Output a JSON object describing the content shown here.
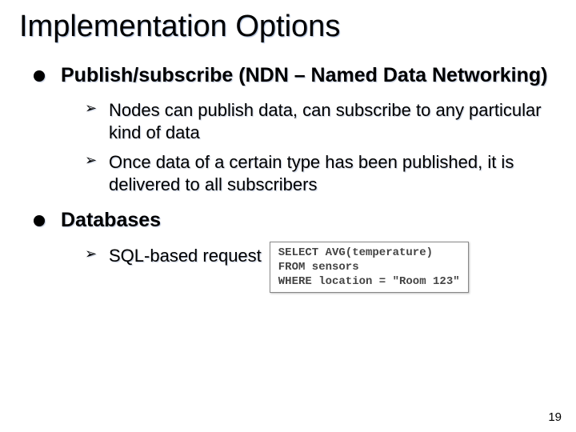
{
  "title": "Implementation Options",
  "points": [
    {
      "text": "Publish/subscribe (NDN – Named Data Networking)",
      "sub": [
        "Nodes can publish data, can subscribe to any particular kind of data",
        "Once data of a certain type has been published, it is delivered to all subscribers"
      ]
    },
    {
      "text": "Databases",
      "sub": [
        "SQL-based request"
      ]
    }
  ],
  "sql_lines": [
    "SELECT AVG(temperature)",
    "FROM sensors",
    "WHERE location = \"Room 123\""
  ],
  "page_number": "19"
}
